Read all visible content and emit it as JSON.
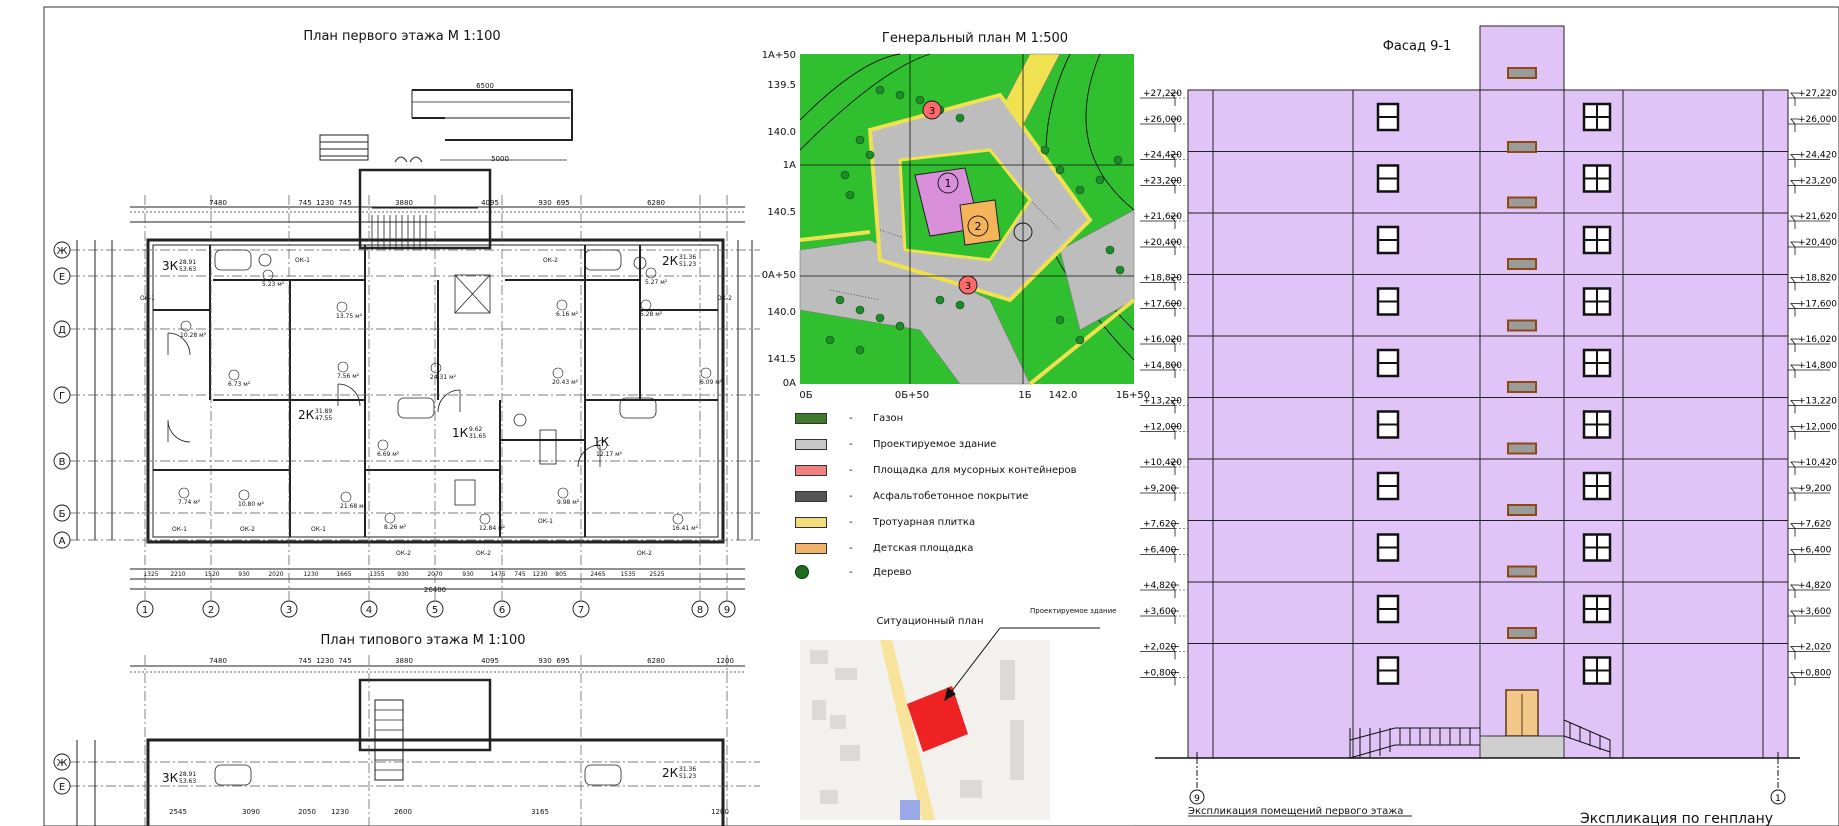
{
  "titles": {
    "first_floor_plan": "План первого этажа М 1:100",
    "typical_floor_plan": "План типового этажа М 1:100",
    "general_plan": "Генеральный план М 1:500",
    "facade": "Фасад 9-1",
    "situation_plan": "Ситуационный план",
    "designed_building_callout": "Проектируемое здание",
    "explication_first_floor": "Экспликация помещений первого этажа",
    "explication_genplan": "Экспликация по генплану"
  },
  "legend": [
    {
      "label": "Газон",
      "color": "#3f7a2a"
    },
    {
      "label": "Проектируемое здание",
      "color": "#c8c8c8"
    },
    {
      "label": "Площадка для мусорных контейнеров",
      "color": "#f08080"
    },
    {
      "label": "Асфальтобетонное покрытие",
      "color": "#555555"
    },
    {
      "label": "Тротуарная плитка",
      "color": "#f3dc7a"
    },
    {
      "label": "Детская площадка",
      "color": "#f2b36b"
    },
    {
      "label": "Дерево",
      "color": "#1e6b1e"
    }
  ],
  "genplan": {
    "row_labels": [
      "1А+50",
      "139.5",
      "140.0",
      "1А",
      "140.5",
      "0А+50",
      "140.0",
      "141.5",
      "0А"
    ],
    "col_labels": [
      "0Б",
      "0Б+50",
      "1Б",
      "142.0",
      "1Б+50"
    ],
    "markers": [
      "1",
      "2",
      "3",
      "3"
    ],
    "colors": {
      "lawn": "#2fbf2f",
      "road": "#bdbdbd",
      "path": "#f0e150",
      "building": "#d98fd9",
      "playground": "#f5b45a",
      "tree": "#1f8a2a"
    }
  },
  "facade": {
    "levels": [
      "+27,220",
      "+26,000",
      "+24,420",
      "+23,200",
      "+21,620",
      "+20,400",
      "+18,820",
      "+17,600",
      "+16,020",
      "+14,800",
      "+13,220",
      "+12,000",
      "+10,420",
      "+9,200",
      "+7,620",
      "+6,400",
      "+4,820",
      "+3,600",
      "+2,020",
      "+0,800"
    ],
    "axes": [
      "9",
      "1"
    ],
    "wall_color": "#e1c4f7"
  },
  "floor_plan": {
    "axes_bottom": [
      "1",
      "2",
      "3",
      "4",
      "5",
      "6",
      "7",
      "8",
      "9"
    ],
    "axes_left": [
      "Ж",
      "Е",
      "Д",
      "Г",
      "В",
      "Б",
      "А"
    ],
    "top_dims": [
      "7480",
      "745",
      "1230",
      "745",
      "3880",
      "4095",
      "930",
      "695",
      "6280"
    ],
    "bottom_dims": [
      "1325",
      "2210",
      "1520",
      "930",
      "2020",
      "1230",
      "1665",
      "1355",
      "930",
      "2070",
      "930",
      "1475",
      "745",
      "1230",
      "805",
      "2465",
      "1535",
      "2525"
    ],
    "total_dim": "26400",
    "porch_dims": [
      "6500",
      "5000"
    ],
    "apartments": [
      {
        "type": "3К",
        "area": "28.91",
        "total": "53.63"
      },
      {
        "type": "2К",
        "area": "31.36",
        "total": "51.23"
      },
      {
        "type": "2К",
        "area": "31.89",
        "total": "47.55"
      },
      {
        "type": "1К",
        "area": "9.62",
        "total": "31.65"
      },
      {
        "type": "1К",
        "area": "",
        "total": ""
      }
    ],
    "window_tags": [
      "ОК-1",
      "ОК-2"
    ],
    "room_areas": [
      "10.28 м²",
      "6.73 м²",
      "13.75 м²",
      "7.56 м²",
      "24.31 м²",
      "20.43 м²",
      "6.16 м²",
      "5.28 м²",
      "6.09 м²",
      "6.69 м²",
      "7.74 м²",
      "10.80 м²",
      "21.68 м²",
      "8.26 м²",
      "12.84 м²",
      "9.98 м²",
      "16.41 м²",
      "5.23 м²",
      "5.27 м²",
      "12.17 м²"
    ]
  },
  "typical_plan": {
    "top_dims": [
      "7480",
      "745",
      "1230",
      "745",
      "3880",
      "4095",
      "930",
      "695",
      "6280",
      "1200"
    ],
    "axes_left": [
      "Ж",
      "Е"
    ],
    "apartments": [
      {
        "type": "3К",
        "area": "28.91",
        "total": "53.63"
      },
      {
        "type": "2К",
        "area": "31.36",
        "total": "51.23"
      }
    ],
    "dims_row": [
      "2545",
      "3090",
      "2050",
      "1230",
      "2600",
      "3165",
      "1200"
    ]
  }
}
